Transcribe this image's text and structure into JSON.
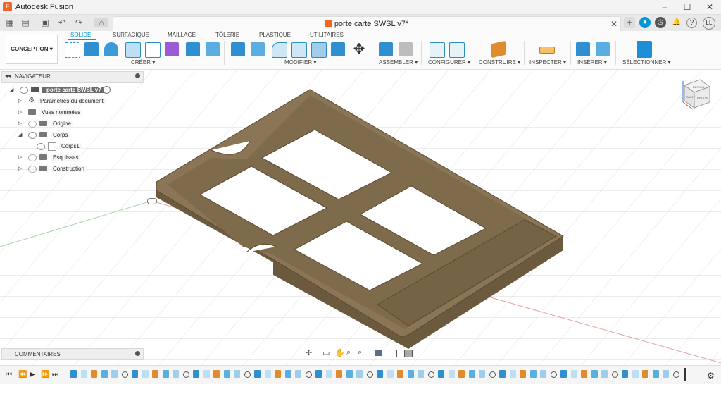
{
  "window": {
    "app_title": "Autodesk Fusion",
    "minimize": "–",
    "maximize": "☐",
    "close": "✕"
  },
  "document_tab": {
    "title": "porte carte SWSL v7*",
    "close": "✕"
  },
  "user": {
    "initials": "LL"
  },
  "ribbon": {
    "workspace": "CONCEPTION ▾",
    "tabs": [
      "SOLIDE",
      "SURFACIQUE",
      "MAILLAGE",
      "TÔLERIE",
      "PLASTIQUE",
      "UTILITAIRES"
    ],
    "active_tab": "SOLIDE",
    "groups": [
      "CRÉER ▾",
      "MODIFIER ▾",
      "ASSEMBLER ▾",
      "CONFIGURER ▾",
      "CONSTRUIRE ▾",
      "INSPECTER ▾",
      "INSÉRER ▾",
      "SÉLECTIONNER ▾"
    ]
  },
  "navigator": {
    "title": "NAVIGATEUR",
    "root": "porte carte SWSL v7",
    "items": [
      {
        "label": "Paramètres du document"
      },
      {
        "label": "Vues nommées"
      },
      {
        "label": "Origine"
      },
      {
        "label": "Corps"
      },
      {
        "label": "Corps1"
      },
      {
        "label": "Esquisses"
      },
      {
        "label": "Construction"
      }
    ]
  },
  "comments": {
    "title": "COMMENTAIRES"
  },
  "viewcube": {
    "top": "DESSUS",
    "front": "AVANT",
    "right": "DROITE"
  },
  "colors": {
    "accent": "#0696d7",
    "model_top": "#8a7656",
    "model_side": "#6e5c40",
    "orange": "#f26522"
  }
}
